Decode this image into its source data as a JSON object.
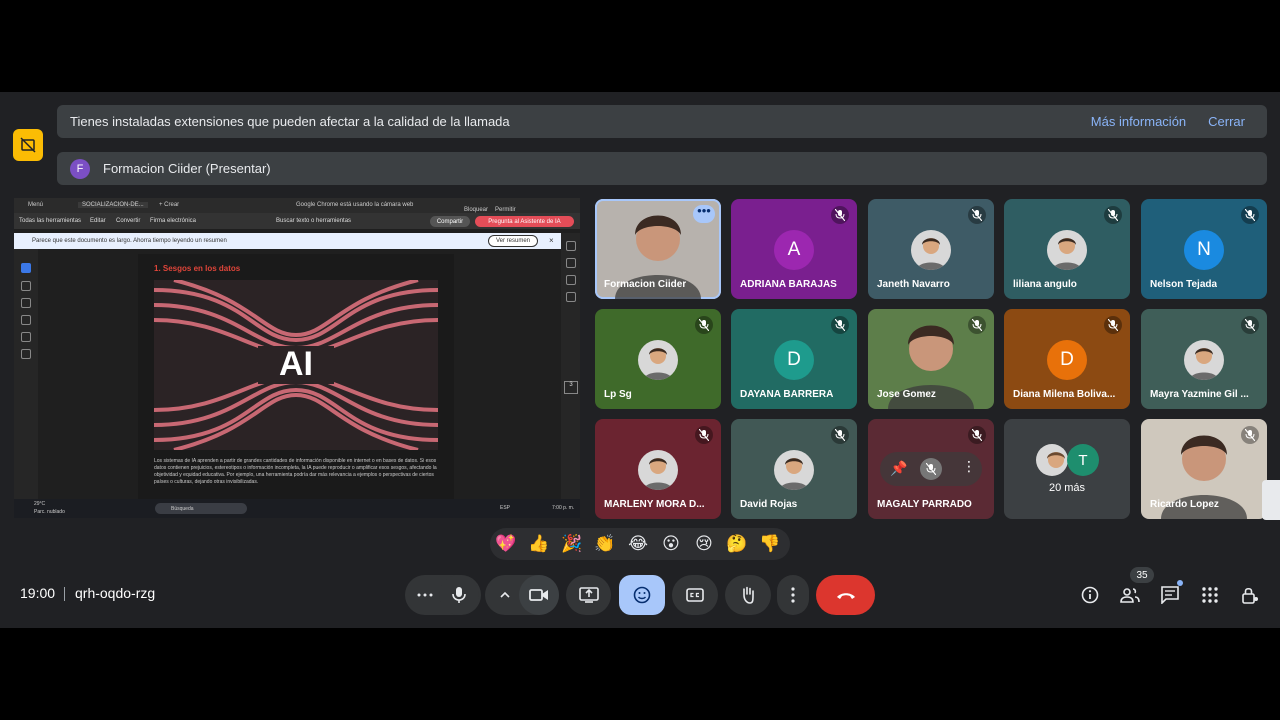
{
  "banners": {
    "extensions_text": "Tienes instaladas extensiones que pueden afectar a la calidad de la llamada",
    "more_info": "Más información",
    "close": "Cerrar",
    "presenter_initial": "F",
    "presenter_text": "Formacion Ciider (Presentar)"
  },
  "shared_screen": {
    "menu_label": "Menú",
    "tab_title": "SOCIALIZACION-DE...",
    "new_tab": "+ Crear",
    "chrome_notice": "Google Chrome está usando la cámara web",
    "block": "Bloquear",
    "allow": "Permitir",
    "toolbar": [
      "Todas las herramientas",
      "Editar",
      "Convertir",
      "Firma electrónica"
    ],
    "search_text": "Buscar texto o herramientas",
    "share_btn": "Compartir",
    "ask_ai": "Pregunta al Asistente de IA",
    "notice": "Parece que este documento es largo. Ahorra tiempo leyendo un resumen",
    "summary_btn": "Ver resumen",
    "page_number": "3",
    "doc_heading": "1. Sesgos en los datos",
    "ai_label": "AI",
    "doc_paragraph": "Los sistemas de IA aprenden a partir de grandes cantidades de información disponible en internet o en bases de datos. Si esos datos contienen prejuicios, estereotipos o información incompleta, la IA puede reproducir o amplificar esos sesgos, afectando la objetividad y equidad educativa. Por ejemplo, una herramienta podría dar más relevancia a ejemplos o perspectivas de ciertos países o culturas, dejando otras invisibilizadas.",
    "weather_temp": "29°C",
    "weather_desc": "Parc. nublado",
    "taskbar_search": "Búsqueda",
    "lang": "ESP",
    "clock": "7:00 p. m."
  },
  "participants": [
    {
      "name": "Formacion Ciider",
      "type": "video",
      "bg": "#b7b2ad",
      "selected": true
    },
    {
      "name": "ADRIANA BARAJAS",
      "type": "letter",
      "letter": "A",
      "bg": "#7a1f8f",
      "avatar": "#9c27b0"
    },
    {
      "name": "Janeth Navarro",
      "type": "photo",
      "bg": "#3e5b66"
    },
    {
      "name": "liliana angulo",
      "type": "photo",
      "bg": "#2f5d62"
    },
    {
      "name": "Nelson Tejada",
      "type": "letter",
      "letter": "N",
      "bg": "#1f5f7a",
      "avatar": "#1a8ae0"
    },
    {
      "name": "Lp Sg",
      "type": "photo",
      "bg": "#3f6a2a"
    },
    {
      "name": "DAYANA BARRERA",
      "type": "letter",
      "letter": "D",
      "bg": "#216b63",
      "avatar": "#1e9b8d"
    },
    {
      "name": "Jose Gomez",
      "type": "video",
      "bg": "#5d7e4a"
    },
    {
      "name": "Diana Milena Boliva...",
      "type": "letter",
      "letter": "D",
      "bg": "#8c4a12",
      "avatar": "#e8710a"
    },
    {
      "name": "Mayra Yazmine Gil ...",
      "type": "photo",
      "bg": "#3f5e58"
    },
    {
      "name": "MARLENY MORA D...",
      "type": "photo",
      "bg": "#6b2430"
    },
    {
      "name": "David Rojas",
      "type": "photo",
      "bg": "#415855"
    },
    {
      "name": "MAGALY PARRADO",
      "type": "letter",
      "letter": "",
      "bg": "#5b2a34",
      "avatar": "#6b3a44"
    },
    {
      "name": "20 más",
      "type": "more",
      "bg": "#3c4043",
      "extra_letter": "T"
    },
    {
      "name": "Ricardo Lopez",
      "type": "video",
      "bg": "#cfc8bd"
    }
  ],
  "reactions": [
    "💖",
    "👍",
    "🎉",
    "👏",
    "😂",
    "😮",
    "😢",
    "🤔",
    "👎"
  ],
  "meeting": {
    "time": "19:00",
    "code": "qrh-oqdo-rzg",
    "participant_count": "35"
  },
  "colors": {
    "meet_bg": "#202124",
    "end_call": "#dc362e",
    "active_reaction": "#a8c7fa",
    "warning": "#fbbc04"
  }
}
